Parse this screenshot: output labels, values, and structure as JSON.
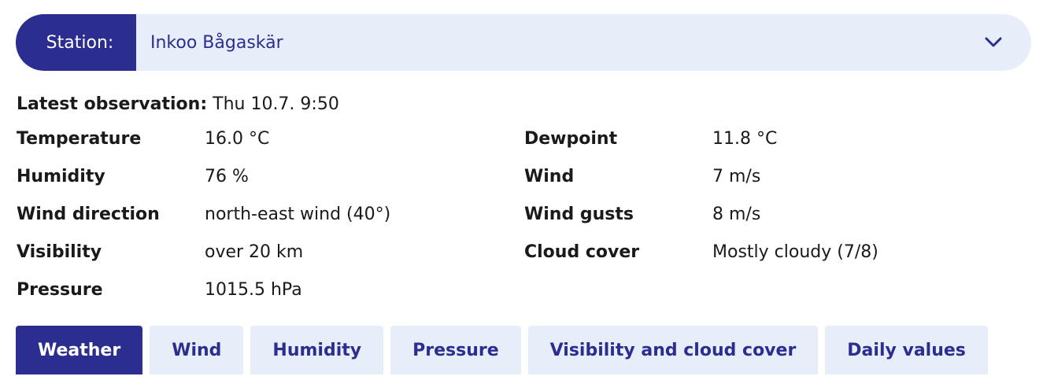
{
  "station": {
    "label": "Station:",
    "selected": "Inkoo Bågaskär",
    "icon": "chevron-down-icon"
  },
  "latest": {
    "label": "Latest observation:",
    "time": "Thu 10.7. 9:50"
  },
  "observations_left": [
    {
      "label": "Temperature",
      "value": "16.0 °C"
    },
    {
      "label": "Humidity",
      "value": "76 %"
    },
    {
      "label": "Wind direction",
      "value": "north-east wind (40°)"
    },
    {
      "label": "Visibility",
      "value": "over 20 km"
    },
    {
      "label": "Pressure",
      "value": "1015.5 hPa"
    }
  ],
  "observations_right": [
    {
      "label": "Dewpoint",
      "value": "11.8 °C"
    },
    {
      "label": "Wind",
      "value": "7 m/s"
    },
    {
      "label": "Wind gusts",
      "value": "8 m/s"
    },
    {
      "label": "Cloud cover",
      "value": "Mostly cloudy (7/8)"
    }
  ],
  "tabs": [
    {
      "label": "Weather",
      "active": true
    },
    {
      "label": "Wind",
      "active": false
    },
    {
      "label": "Humidity",
      "active": false
    },
    {
      "label": "Pressure",
      "active": false
    },
    {
      "label": "Visibility and cloud cover",
      "active": false
    },
    {
      "label": "Daily values",
      "active": false
    }
  ],
  "colors": {
    "accent": "#2c2e8f",
    "light_bg": "#e8eef9"
  }
}
